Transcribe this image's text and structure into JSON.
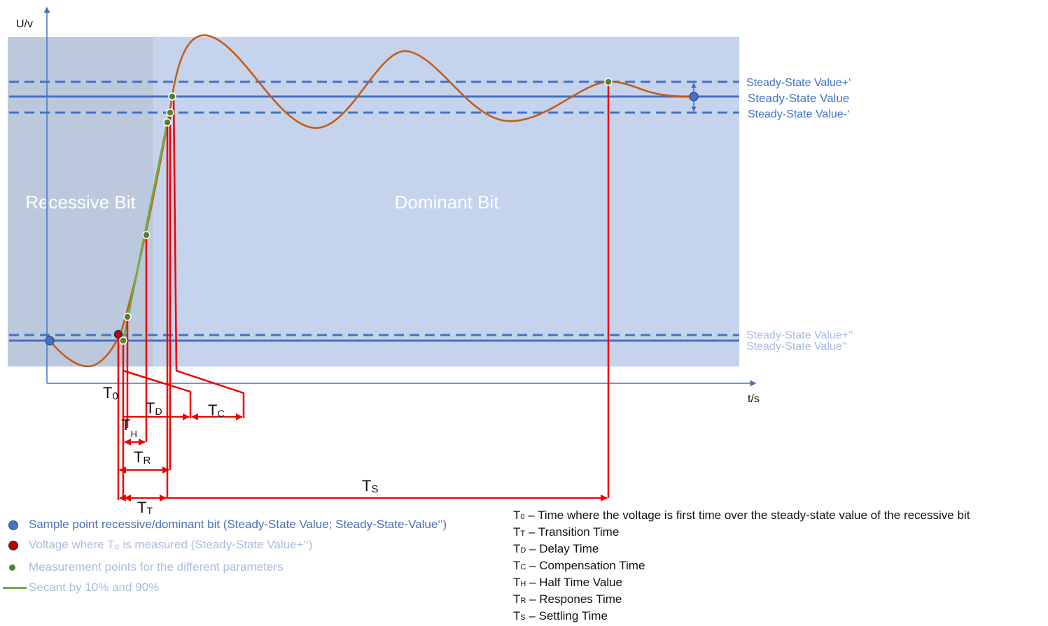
{
  "axes": {
    "y_label": "U/v",
    "x_label": "t/s"
  },
  "regions": {
    "recessive_label": "Recessive Bit",
    "dominant_label": "Dominant Bit"
  },
  "reference_lines": {
    "upper_plus": "Steady-State Value+‘",
    "upper": "Steady-State Value",
    "upper_minus": "Steady-State Value-‘",
    "lower_plus": "Steady-State Value+‘‘",
    "lower": "Steady-State Value‘‘"
  },
  "interval_labels": {
    "t0": {
      "main": "T",
      "sub": "0"
    },
    "td": {
      "main": "T",
      "sub": "D"
    },
    "tc": {
      "main": "T",
      "sub": "C"
    },
    "th": {
      "main": "T",
      "sub": "H"
    },
    "tr": {
      "main": "T",
      "sub": "R"
    },
    "ts": {
      "main": "T",
      "sub": "S"
    },
    "tt": {
      "main": "T",
      "sub": "T"
    }
  },
  "legend": [
    {
      "marker": "blue-dot",
      "text": "Sample point recessive/dominant bit (Steady-State Value; Steady-State-Value‘‘)",
      "color": "#4a6fbf"
    },
    {
      "marker": "red-dot",
      "text": "Voltage where T₀ is measured (Steady-State Value+‘‘)",
      "color": "#a9bce0"
    },
    {
      "marker": "green-dot",
      "text": "Measurement points for the different parameters",
      "color": "#a9bce0"
    },
    {
      "marker": "green-line",
      "text": "Secant by 10% and 90%",
      "color": "#a9bce0"
    }
  ],
  "definitions": [
    {
      "sym": "T",
      "sub": "0",
      "text": " – Time where the voltage is first time over the steady-state value of the recessive bit"
    },
    {
      "sym": "T",
      "sub": "T",
      "text": " – Transition Time"
    },
    {
      "sym": "T",
      "sub": "D",
      "text": " – Delay Time"
    },
    {
      "sym": "T",
      "sub": "C",
      "text": " – Compensation Time"
    },
    {
      "sym": "T",
      "sub": "H",
      "text": " – Half Time Value"
    },
    {
      "sym": "T",
      "sub": "R",
      "text": " – Respones Time"
    },
    {
      "sym": "T",
      "sub": "S",
      "text": " – Settling Time"
    }
  ],
  "colors": {
    "recessive_bg": "#bcc8dc",
    "dominant_bg": "#c5d3ec",
    "line_blue": "#4472c4",
    "curve": "#c55a11",
    "secant": "#70ad47",
    "marker_red": "#ee0000"
  }
}
